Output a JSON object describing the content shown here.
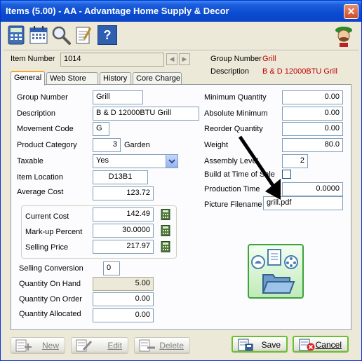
{
  "window": {
    "title": "Items (5.00) - AA - Advantage Home Supply & Decor",
    "close_symbol": "✕"
  },
  "toolbar": {
    "icons": [
      "calculator-icon",
      "calendar-icon",
      "magnifier-icon",
      "notepad-icon",
      "help-book-icon",
      "mascot-icon"
    ],
    "help_glyph": "?"
  },
  "header": {
    "item_number_label": "Item Number",
    "item_number": "1014",
    "group_number_label": "Group Number",
    "group_number_value": "Grill",
    "description_label": "Description",
    "description_value": "B & D 12000BTU Grill",
    "nav_prev": "◀",
    "nav_next": "▶"
  },
  "tabs": [
    "General",
    "Web Store",
    "History",
    "Core Charge"
  ],
  "general": {
    "group_number_label": "Group Number",
    "group_number": "Grill",
    "description_label": "Description",
    "description": "B & D 12000BTU Grill",
    "movement_code_label": "Movement Code",
    "movement_code": "G",
    "product_category_label": "Product Category",
    "product_category": "3",
    "product_category_name": "Garden",
    "taxable_label": "Taxable",
    "taxable": "Yes",
    "item_location_label": "Item Location",
    "item_location": "D13B1",
    "average_cost_label": "Average Cost",
    "average_cost": "123.72",
    "current_cost_label": "Current Cost",
    "current_cost": "142.49",
    "markup_percent_label": "Mark-up Percent",
    "markup_percent": "30.0000",
    "selling_price_label": "Selling Price",
    "selling_price": "217.97",
    "selling_conversion_label": "Selling Conversion",
    "selling_conversion": "0",
    "qty_on_hand_label": "Quantity On Hand",
    "qty_on_hand": "5.00",
    "qty_on_order_label": "Quantity On Order",
    "qty_on_order": "0.00",
    "qty_allocated_label": "Quantity Allocated",
    "qty_allocated": "0.00",
    "min_qty_label": "Minimum Quantity",
    "min_qty": "0.00",
    "abs_min_label": "Absolute Minimum",
    "abs_min": "0.00",
    "reorder_qty_label": "Reorder Quantity",
    "reorder_qty": "0.00",
    "weight_label": "Weight",
    "weight": "80.0",
    "assembly_level_label": "Assembly Level",
    "assembly_level": "2",
    "build_at_time_label": "Build at Time of Sale",
    "build_at_time_checked": false,
    "production_time_label": "Production Time",
    "production_time": "0.0000",
    "picture_filename_label": "Picture Filename",
    "picture_filename": "grill.pdf"
  },
  "buttons": {
    "new_label": "New",
    "edit_label": "Edit",
    "delete_label": "Delete",
    "save_label": "Save",
    "cancel_label": "Cancel"
  },
  "colors": {
    "title_bar": "#0a4bd1",
    "header_value_red": "#c00000",
    "active_tab_accent": "#f5a623",
    "media_box_green": "#3ca338"
  }
}
